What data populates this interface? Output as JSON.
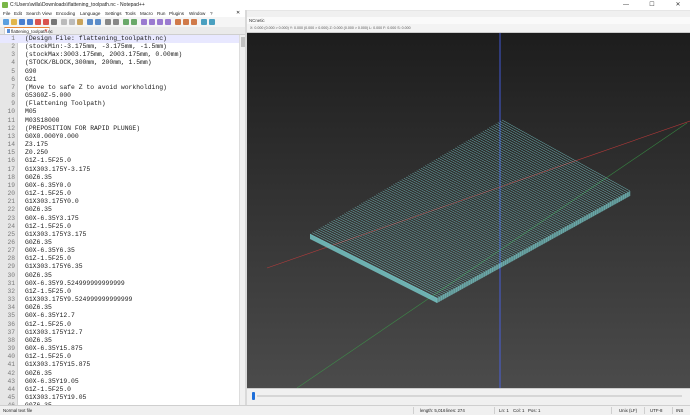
{
  "window": {
    "title": "C:\\Users\\willa\\Downloads\\flattening_toolpath.nc - Notepad++",
    "minimize": "—",
    "maximize": "☐",
    "close": "✕"
  },
  "menu": [
    "File",
    "Edit",
    "Search",
    "View",
    "Encoding",
    "Language",
    "Settings",
    "Tools",
    "Macro",
    "Run",
    "Plugins",
    "Window",
    "?"
  ],
  "menu_close": "✕",
  "tab": {
    "label": "flattening_toolpath.nc",
    "close": "✕"
  },
  "editor": {
    "lines": [
      {
        "n": "1",
        "text": "(Design File: flattening_toolpath.nc)"
      },
      {
        "n": "2",
        "text": "(stockMin:-3.175mm, -3.175mm, -1.5mm)"
      },
      {
        "n": "3",
        "text": "(stockMax:3003.175mm, 2003.175mm, 0.00mm)"
      },
      {
        "n": "4",
        "text": "(STOCK/BLOCK,300mm, 200mm, 1.5mm)"
      },
      {
        "n": "5",
        "text": "G90"
      },
      {
        "n": "6",
        "text": "G21"
      },
      {
        "n": "7",
        "text": "(Move to safe Z to avoid workholding)"
      },
      {
        "n": "8",
        "text": "G53G0Z-5.000"
      },
      {
        "n": "9",
        "text": "(Flattening Toolpath)"
      },
      {
        "n": "10",
        "text": "M05"
      },
      {
        "n": "11",
        "text": "M03S18000"
      },
      {
        "n": "12",
        "text": "(PREPOSITION FOR RAPID PLUNGE)"
      },
      {
        "n": "13",
        "text": "G0X0.000Y0.000"
      },
      {
        "n": "14",
        "text": "Z3.175"
      },
      {
        "n": "15",
        "text": "Z0.250"
      },
      {
        "n": "16",
        "text": "G1Z-1.5F25.0"
      },
      {
        "n": "17",
        "text": "G1X303.175Y-3.175"
      },
      {
        "n": "18",
        "text": "G0Z6.35"
      },
      {
        "n": "19",
        "text": "G0X-6.35Y0.0"
      },
      {
        "n": "20",
        "text": "G1Z-1.5F25.0"
      },
      {
        "n": "21",
        "text": "G1X303.175Y0.0"
      },
      {
        "n": "22",
        "text": "G0Z6.35"
      },
      {
        "n": "23",
        "text": "G0X-6.35Y3.175"
      },
      {
        "n": "24",
        "text": "G1Z-1.5F25.0"
      },
      {
        "n": "25",
        "text": "G1X303.175Y3.175"
      },
      {
        "n": "26",
        "text": "G0Z6.35"
      },
      {
        "n": "27",
        "text": "G0X-6.35Y6.35"
      },
      {
        "n": "28",
        "text": "G1Z-1.5F25.0"
      },
      {
        "n": "29",
        "text": "G1X303.175Y6.35"
      },
      {
        "n": "30",
        "text": "G0Z6.35"
      },
      {
        "n": "31",
        "text": "G0X-6.35Y9.524999999999999"
      },
      {
        "n": "32",
        "text": "G1Z-1.5F25.0"
      },
      {
        "n": "33",
        "text": "G1X303.175Y9.524999999999999"
      },
      {
        "n": "34",
        "text": "G0Z6.35"
      },
      {
        "n": "35",
        "text": "G0X-6.35Y12.7"
      },
      {
        "n": "36",
        "text": "G1Z-1.5F25.0"
      },
      {
        "n": "37",
        "text": "G1X303.175Y12.7"
      },
      {
        "n": "38",
        "text": "G0Z6.35"
      },
      {
        "n": "39",
        "text": "G0X-6.35Y15.875"
      },
      {
        "n": "40",
        "text": "G1Z-1.5F25.0"
      },
      {
        "n": "41",
        "text": "G1X303.175Y15.875"
      },
      {
        "n": "42",
        "text": "G0Z6.35"
      },
      {
        "n": "43",
        "text": "G0X-6.35Y19.05"
      },
      {
        "n": "44",
        "text": "G1Z-1.5F25.0"
      },
      {
        "n": "45",
        "text": "G1X303.175Y19.05"
      },
      {
        "n": "46",
        "text": "G0Z6.35"
      }
    ]
  },
  "viewer": {
    "title": "NCnetic",
    "coords": "X: 0.000 (0.000 > 0.000)   Y: 0.000 (0.000 > 0.000)   Z: 0.000 (0.000 > 0.000)   L: 0.000   F: 0.000   S: 0.000",
    "colors": {
      "background_top": "#1d1d1d",
      "background_bottom": "#4b4b4b",
      "toolpath": "#7fd8d8",
      "x_axis": "#d23c3c",
      "y_axis": "#4a66ff",
      "z_axis": "#3aa84a"
    }
  },
  "status": {
    "type": "Normal text file",
    "length": "length: 5,016",
    "lines": "lines: 274",
    "ln": "Ln: 1",
    "col": "Col: 1",
    "pos": "Pos: 1",
    "eol": "Unix (LF)",
    "encoding": "UTF-8",
    "mode": "INS"
  }
}
